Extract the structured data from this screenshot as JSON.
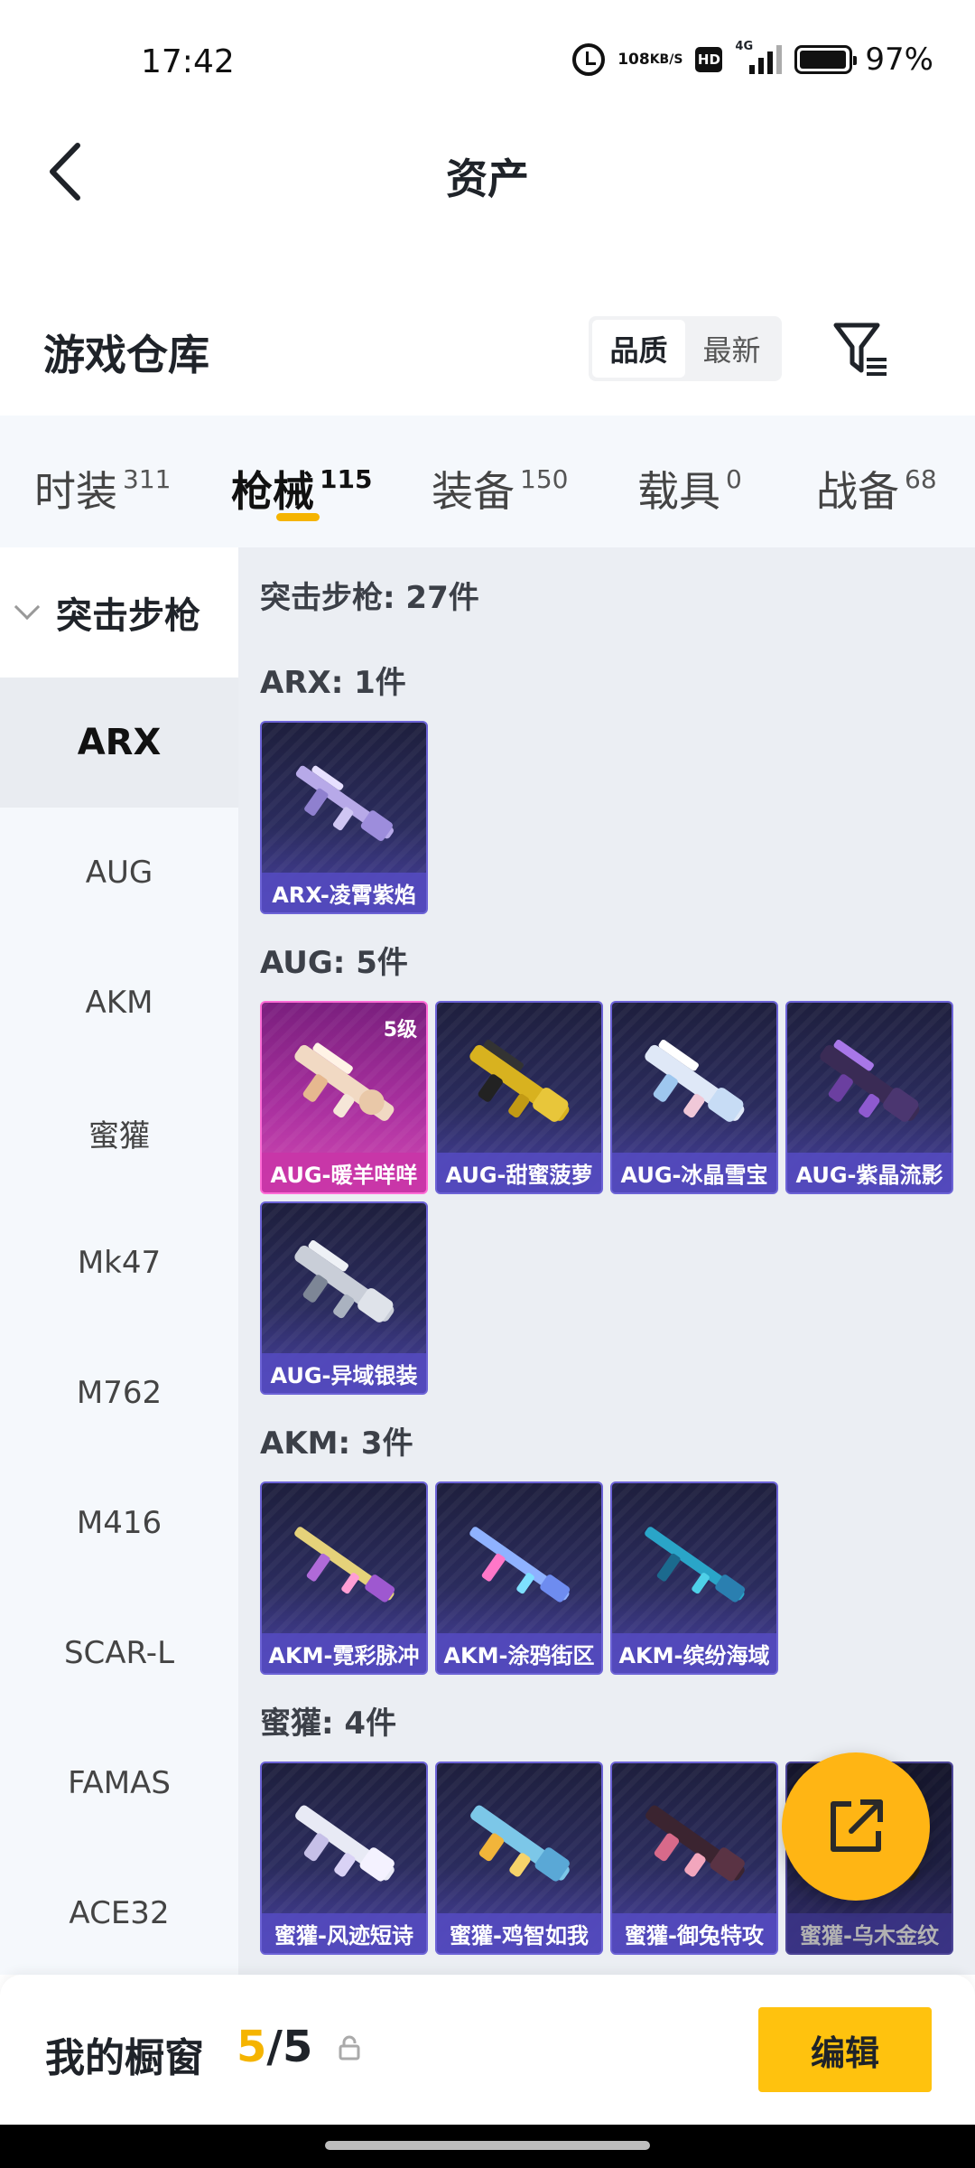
{
  "status_bar": {
    "time": "17:42",
    "speed_value": "108",
    "speed_unit": "KB/S",
    "hd": "HD",
    "network": "4G",
    "battery": "97%"
  },
  "header": {
    "title": "资产"
  },
  "warehouse": {
    "title": "游戏仓库",
    "sort_options": [
      "品质",
      "最新"
    ],
    "active_sort": "品质"
  },
  "categories": [
    {
      "name": "时装",
      "count": "311"
    },
    {
      "name": "枪械",
      "count": "115"
    },
    {
      "name": "装备",
      "count": "150"
    },
    {
      "name": "载具",
      "count": "0"
    },
    {
      "name": "战备",
      "count": "68"
    }
  ],
  "active_category": "枪械",
  "sidebar": {
    "group": "突击步枪",
    "items": [
      "ARX",
      "AUG",
      "AKM",
      "蜜獾",
      "Mk47",
      "M762",
      "M416",
      "SCAR-L",
      "FAMAS",
      "ACE32"
    ],
    "active": "ARX"
  },
  "main": {
    "total": "突击步枪: 27件",
    "groups": [
      {
        "title": "ARX: 1件",
        "items": [
          {
            "label": "ARX-凌霄紫焰"
          }
        ]
      },
      {
        "title": "AUG: 5件",
        "items": [
          {
            "label": "AUG-暖羊咩咩",
            "level": "5级"
          },
          {
            "label": "AUG-甜蜜菠萝"
          },
          {
            "label": "AUG-冰晶雪宝"
          },
          {
            "label": "AUG-紫晶流影"
          },
          {
            "label": "AUG-异域银装"
          }
        ]
      },
      {
        "title": "AKM: 3件",
        "items": [
          {
            "label": "AKM-霓彩脉冲"
          },
          {
            "label": "AKM-涂鸦街区"
          },
          {
            "label": "AKM-缤纷海域"
          }
        ]
      },
      {
        "title": "蜜獾: 4件",
        "items": [
          {
            "label": "蜜獾-风迹短诗"
          },
          {
            "label": "蜜獾-鸡智如我"
          },
          {
            "label": "蜜獾-御兔特攻"
          },
          {
            "label": "蜜獾-乌木金纹"
          }
        ]
      }
    ]
  },
  "bottom": {
    "showcase_title": "我的橱窗",
    "current": "5",
    "separator": "/",
    "max": "5",
    "edit_label": "编辑"
  },
  "icons": {
    "back": "chevron-left-icon",
    "filter": "filter-icon",
    "share": "share-external-icon",
    "lock": "lock-icon"
  },
  "colors": {
    "accent": "#f5b400",
    "edit_button": "#ffc20e",
    "fab": "#ffb514",
    "card_purple": "#4a42a3",
    "card_gold": "#d34ab4"
  }
}
